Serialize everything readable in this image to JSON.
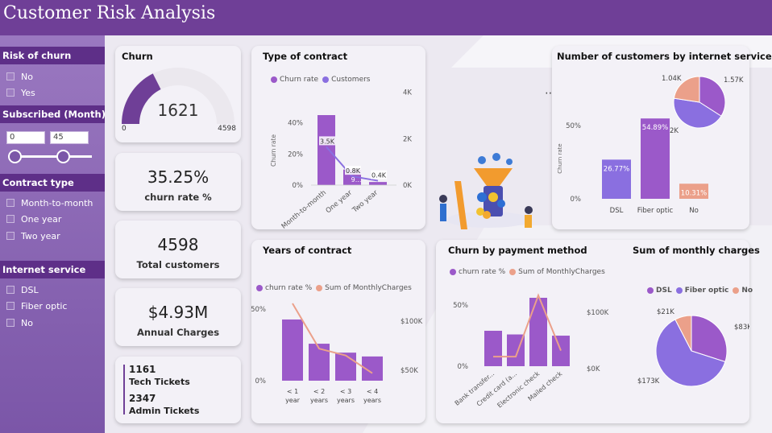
{
  "header": {
    "title": "Customer Risk Analysis"
  },
  "sidebar": {
    "risk_title": "Risk of churn",
    "risk_options": [
      "No",
      "Yes"
    ],
    "subscribed_title": "Subscribed (Month)",
    "subscribed_min": "0",
    "subscribed_max": "45",
    "contract_title": "Contract type",
    "contract_options": [
      "Month-to-month",
      "One year",
      "Two year"
    ],
    "internet_title": "Internet service",
    "internet_options": [
      "DSL",
      "Fiber optic",
      "No"
    ]
  },
  "churn_gauge": {
    "title": "Churn",
    "value": "1621",
    "min": "0",
    "max": "4598",
    "fraction": 0.3525
  },
  "kpis": {
    "churn_rate": {
      "value": "35.25%",
      "label": "churn rate %"
    },
    "total_customers": {
      "value": "4598",
      "label": "Total customers"
    },
    "annual_charges": {
      "value": "$4.93M",
      "label": "Annual Charges"
    }
  },
  "tickets": {
    "tech_value": "1161",
    "tech_label": "Tech Tickets",
    "admin_value": "2347",
    "admin_label": "Admin Tickets"
  },
  "menu_icon": "ellipsis-icon",
  "illustration": "funnel-analytics-illustration",
  "colors": {
    "purple": "#9b59c9",
    "lavender": "#8a6fe0",
    "salmon": "#eba08a",
    "header": "#6f3f97"
  },
  "chart_data": [
    {
      "type": "bar",
      "title": "Type of contract",
      "legend": [
        "Churn rate",
        "Customers"
      ],
      "categories": [
        "Month-to-month",
        "One year",
        "Two year"
      ],
      "series": [
        {
          "name": "Churn rate",
          "values": [
            0.45,
            0.1,
            0.02
          ]
        },
        {
          "name": "Customers",
          "values": [
            3500,
            800,
            400
          ],
          "labels": [
            "3.5K",
            "0.8K",
            "0.4K"
          ]
        }
      ],
      "ylabel": "Churn rate",
      "yticks_left": [
        "40%",
        "20%",
        "0%"
      ],
      "yticks_right": [
        "4K",
        "2K",
        "0K"
      ],
      "overlap_label": "9..."
    },
    {
      "type": "bar",
      "title": "Number of customers by internet service",
      "categories": [
        "DSL",
        "Fiber optic",
        "No"
      ],
      "values": [
        26.77,
        54.89,
        10.31
      ],
      "labels": [
        "26.77%",
        "54.89%",
        "10.31%"
      ],
      "ylabel": "Churn rate",
      "yticks": [
        "50%",
        "0%"
      ]
    },
    {
      "type": "pie",
      "title": "",
      "slices": [
        {
          "label": "1.57K",
          "value": 1570
        },
        {
          "label": "2K",
          "value": 2000
        },
        {
          "label": "1.04K",
          "value": 1040
        }
      ]
    },
    {
      "type": "bar",
      "title": "Years of contract",
      "legend": [
        "churn rate %",
        "Sum of MonthlyCharges"
      ],
      "categories": [
        "< 1 year",
        "< 2 years",
        "< 3 years",
        "< 4 years"
      ],
      "series": [
        {
          "name": "churn rate %",
          "values": [
            0.48,
            0.29,
            0.22,
            0.19
          ]
        },
        {
          "name": "Sum of MonthlyCharges",
          "values": [
            118000,
            72000,
            65000,
            47000
          ]
        }
      ],
      "yticks_left": [
        "50%",
        "0%"
      ],
      "yticks_right": [
        "$100K",
        "$50K"
      ]
    },
    {
      "type": "bar",
      "title": "Churn by payment method",
      "legend": [
        "churn rate %",
        "Sum of MonthlyCharges"
      ],
      "categories": [
        "Bank transfer...",
        "Credit card (a...",
        "Electronic check",
        "Mailed check"
      ],
      "series": [
        {
          "name": "churn rate %",
          "values": [
            0.29,
            0.26,
            0.56,
            0.25
          ]
        },
        {
          "name": "Sum of MonthlyCharges",
          "values": [
            20000,
            20000,
            122000,
            30000
          ]
        }
      ],
      "yticks_left": [
        "50%",
        "0%"
      ],
      "yticks_right": [
        "$100K",
        "$0K"
      ]
    },
    {
      "type": "pie",
      "title": "Sum of monthly charges",
      "legend": [
        "DSL",
        "Fiber optic",
        "No"
      ],
      "slices": [
        {
          "label": "$83K",
          "value": 83
        },
        {
          "label": "$173K",
          "value": 173
        },
        {
          "label": "$21K",
          "value": 21
        }
      ]
    }
  ]
}
